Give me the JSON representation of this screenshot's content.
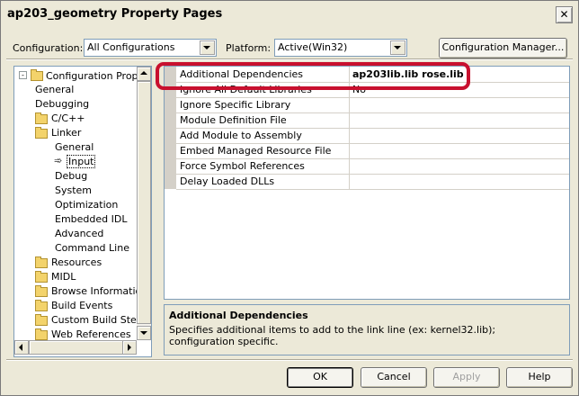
{
  "window": {
    "title": "ap203_geometry Property Pages",
    "close_glyph": "✕"
  },
  "config": {
    "label": "Configuration:",
    "value": "All Configurations"
  },
  "platform": {
    "label": "Platform:",
    "value": "Active(Win32)"
  },
  "config_manager_label": "Configuration Manager...",
  "tree": {
    "root": "Configuration Properties",
    "items": [
      {
        "label": "General"
      },
      {
        "label": "Debugging"
      },
      {
        "label": "C/C++"
      },
      {
        "label": "Linker"
      },
      {
        "label": "General"
      },
      {
        "label": "Input"
      },
      {
        "label": "Debug"
      },
      {
        "label": "System"
      },
      {
        "label": "Optimization"
      },
      {
        "label": "Embedded IDL"
      },
      {
        "label": "Advanced"
      },
      {
        "label": "Command Line"
      },
      {
        "label": "Resources"
      },
      {
        "label": "MIDL"
      },
      {
        "label": "Browse Information"
      },
      {
        "label": "Build Events"
      },
      {
        "label": "Custom Build Step"
      },
      {
        "label": "Web References"
      }
    ]
  },
  "properties": [
    {
      "name": "Additional Dependencies",
      "value": "ap203lib.lib rose.lib"
    },
    {
      "name": "Ignore All Default Libraries",
      "value": "No"
    },
    {
      "name": "Ignore Specific Library",
      "value": ""
    },
    {
      "name": "Module Definition File",
      "value": ""
    },
    {
      "name": "Add Module to Assembly",
      "value": ""
    },
    {
      "name": "Embed Managed Resource File",
      "value": ""
    },
    {
      "name": "Force Symbol References",
      "value": ""
    },
    {
      "name": "Delay Loaded DLLs",
      "value": ""
    }
  ],
  "description": {
    "title": "Additional Dependencies",
    "text": "Specifies additional items to add to the link line (ex: kernel32.lib); configuration specific."
  },
  "buttons": {
    "ok": "OK",
    "cancel": "Cancel",
    "apply": "Apply",
    "help": "Help"
  },
  "colors": {
    "highlight_outline": "#c8102e",
    "dialog_bg": "#ece9d8"
  }
}
